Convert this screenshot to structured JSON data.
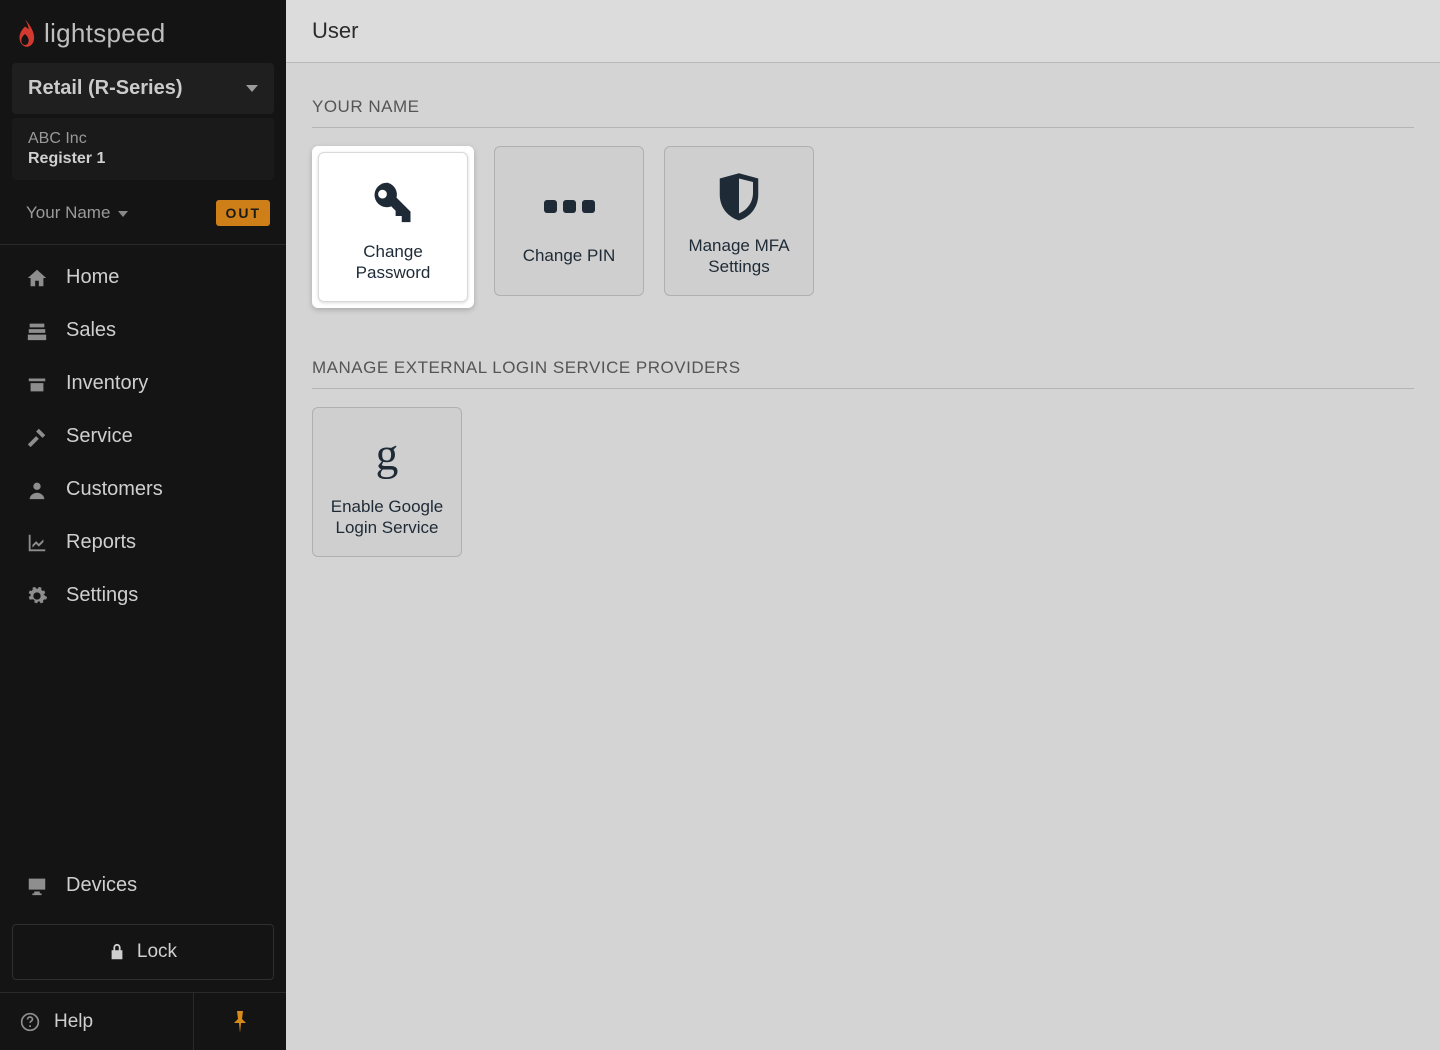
{
  "brand": {
    "name": "lightspeed"
  },
  "sidebar": {
    "product_selector": "Retail (R-Series)",
    "company": "ABC Inc",
    "register": "Register 1",
    "user_label": "Your Name",
    "out_badge": "OUT",
    "nav": [
      {
        "label": "Home"
      },
      {
        "label": "Sales"
      },
      {
        "label": "Inventory"
      },
      {
        "label": "Service"
      },
      {
        "label": "Customers"
      },
      {
        "label": "Reports"
      },
      {
        "label": "Settings"
      }
    ],
    "devices_label": "Devices",
    "lock_label": "Lock",
    "help_label": "Help"
  },
  "page": {
    "title": "User",
    "sections": [
      {
        "heading": "YOUR NAME",
        "tiles": [
          {
            "label": "Change Password",
            "highlighted": true,
            "icon": "key"
          },
          {
            "label": "Change PIN",
            "highlighted": false,
            "icon": "pin-dots"
          },
          {
            "label": "Manage MFA Settings",
            "highlighted": false,
            "icon": "shield"
          }
        ]
      },
      {
        "heading": "MANAGE EXTERNAL LOGIN SERVICE PROVIDERS",
        "tiles": [
          {
            "label": "Enable Google Login Service",
            "highlighted": false,
            "icon": "google"
          }
        ]
      }
    ]
  }
}
